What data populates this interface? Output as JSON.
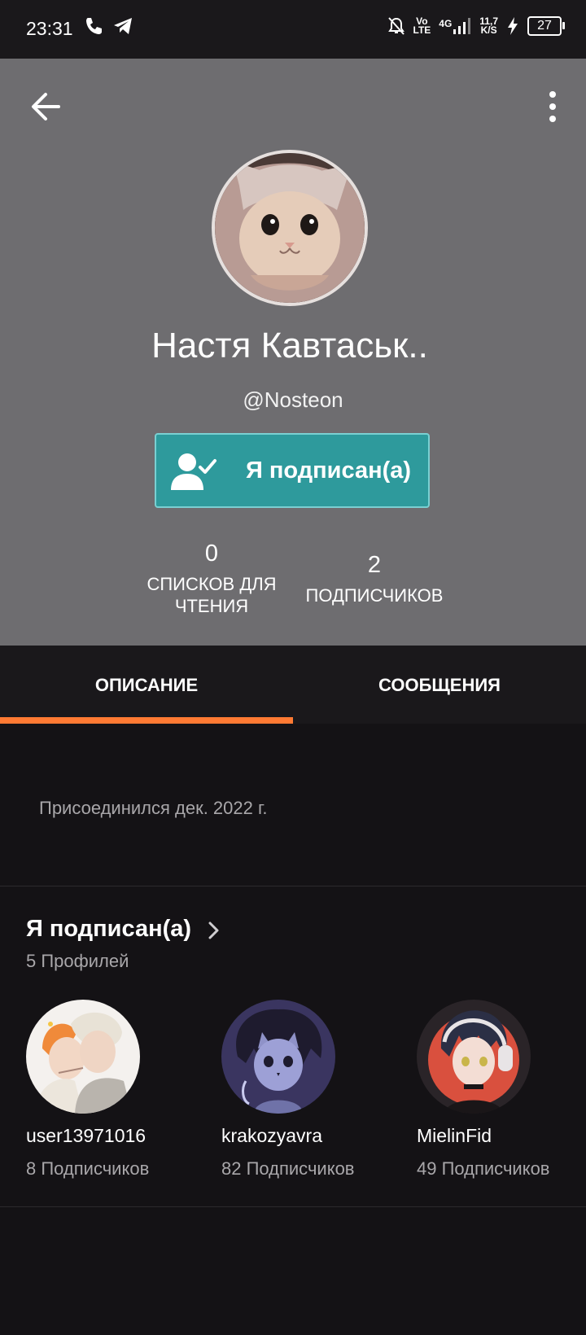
{
  "status_bar": {
    "time": "23:31",
    "volte_top": "Vo",
    "volte_bottom": "LTE",
    "network": "4G",
    "speed_top": "11,7",
    "speed_bottom": "K/S",
    "battery": "27"
  },
  "profile": {
    "name": "Настя Кавтаськ..",
    "handle": "@Nosteon",
    "follow_button_label": "Я подписан(а)",
    "stats": {
      "reading_lists_count": "0",
      "reading_lists_label_line1": "СПИСКОВ ДЛЯ",
      "reading_lists_label_line2": "ЧТЕНИЯ",
      "followers_count": "2",
      "followers_label": "ПОДПИСЧИКОВ"
    }
  },
  "tabs": [
    {
      "label": "ОПИСАНИЕ",
      "active": true
    },
    {
      "label": "СООБЩЕНИЯ",
      "active": false
    }
  ],
  "about": {
    "joined": "Присоединился дек. 2022 г."
  },
  "following": {
    "title": "Я подписан(а)",
    "subtitle": "5 Профилей",
    "profiles": [
      {
        "username": "user13971016",
        "followers": "8 Подписчиков"
      },
      {
        "username": "krakozyavra",
        "followers": "82 Подписчиков"
      },
      {
        "username": "MielinFid",
        "followers": "49 Подписчиков"
      }
    ]
  },
  "colors": {
    "header_bg": "#6e6d70",
    "accent_button": "#2e9a9c",
    "tab_indicator": "#ff7a33",
    "page_bg": "#141215"
  }
}
